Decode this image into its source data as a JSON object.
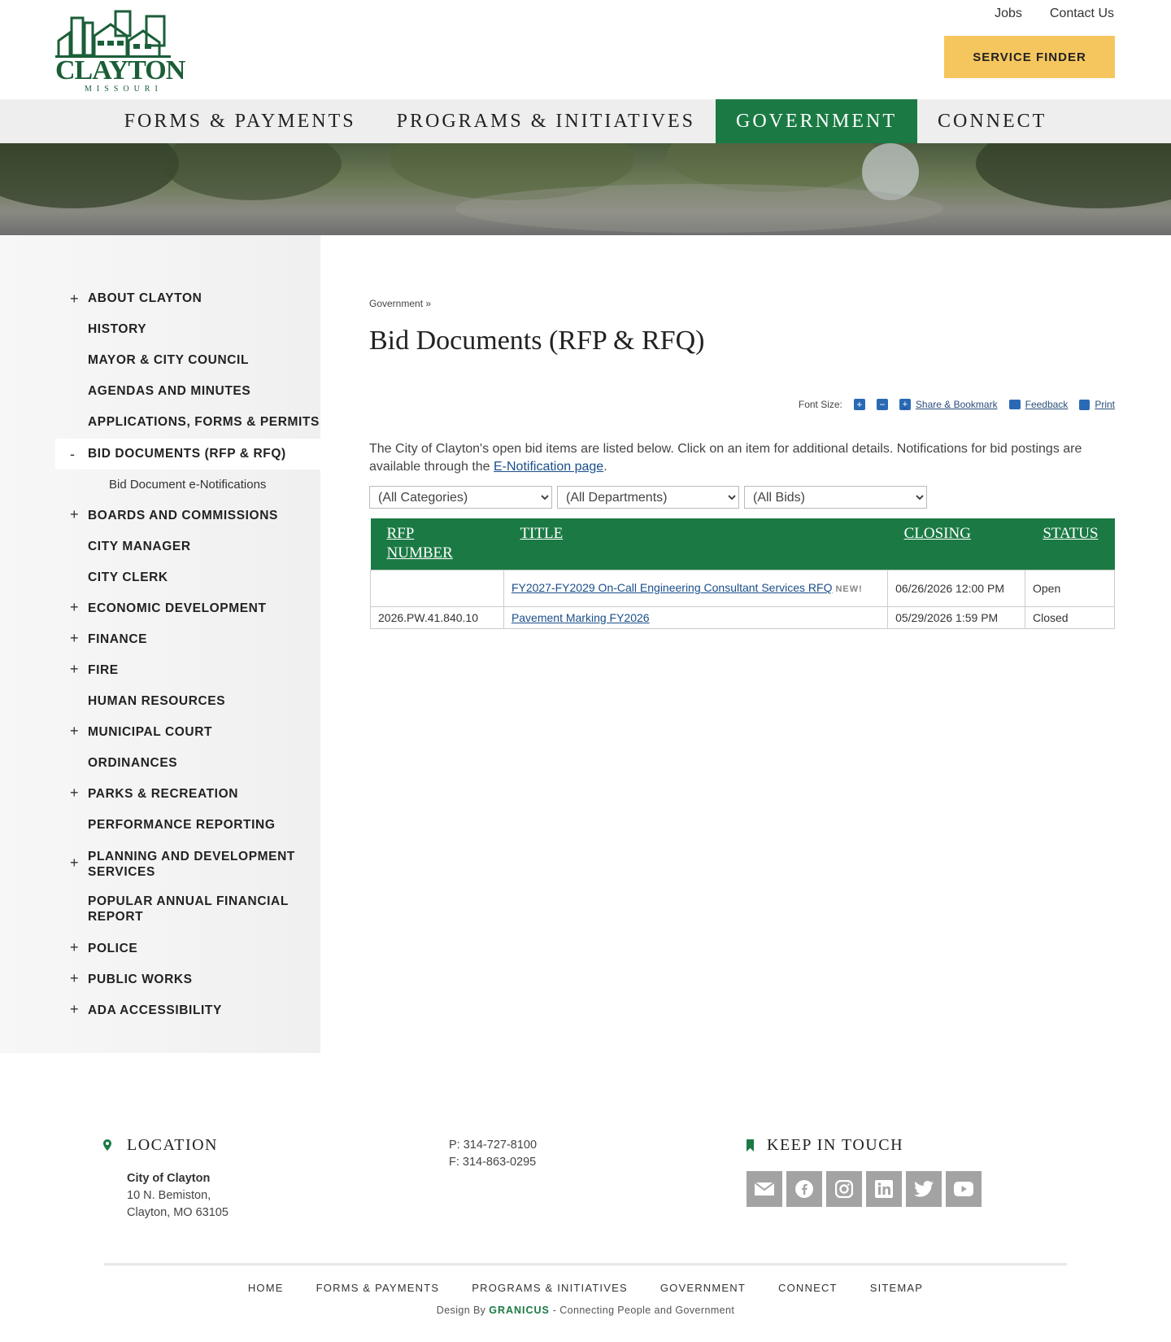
{
  "header": {
    "logo_text": "CLAYTON",
    "logo_subtext": "MISSOURI",
    "top_links": [
      "Jobs",
      "Contact Us"
    ],
    "service_finder": "SERVICE FINDER"
  },
  "nav": {
    "items": [
      "FORMS & PAYMENTS",
      "PROGRAMS & INITIATIVES",
      "GOVERNMENT",
      "CONNECT"
    ],
    "active": "GOVERNMENT"
  },
  "sidebar": {
    "items": [
      {
        "label": "ABOUT CLAYTON",
        "toggle": "+"
      },
      {
        "label": "HISTORY",
        "toggle": ""
      },
      {
        "label": "MAYOR & CITY COUNCIL",
        "toggle": ""
      },
      {
        "label": "AGENDAS AND MINUTES",
        "toggle": ""
      },
      {
        "label": "APPLICATIONS, FORMS & PERMITS",
        "toggle": ""
      },
      {
        "label": "BID DOCUMENTS (RFP & RFQ)",
        "toggle": "-"
      },
      {
        "label": "BOARDS AND COMMISSIONS",
        "toggle": "+"
      },
      {
        "label": "CITY MANAGER",
        "toggle": ""
      },
      {
        "label": "CITY CLERK",
        "toggle": ""
      },
      {
        "label": "ECONOMIC DEVELOPMENT",
        "toggle": "+"
      },
      {
        "label": "FINANCE",
        "toggle": "+"
      },
      {
        "label": "FIRE",
        "toggle": "+"
      },
      {
        "label": "HUMAN RESOURCES",
        "toggle": ""
      },
      {
        "label": "MUNICIPAL COURT",
        "toggle": "+"
      },
      {
        "label": "ORDINANCES",
        "toggle": ""
      },
      {
        "label": "PARKS & RECREATION",
        "toggle": "+"
      },
      {
        "label": "PERFORMANCE REPORTING",
        "toggle": ""
      },
      {
        "label": "PLANNING AND DEVELOPMENT SERVICES",
        "toggle": "+"
      },
      {
        "label": "POPULAR ANNUAL FINANCIAL REPORT",
        "toggle": ""
      },
      {
        "label": "POLICE",
        "toggle": "+"
      },
      {
        "label": "PUBLIC WORKS",
        "toggle": "+"
      },
      {
        "label": "ADA ACCESSIBILITY",
        "toggle": "+"
      }
    ],
    "subitem": "Bid Document e-Notifications"
  },
  "content": {
    "breadcrumb": "Government »",
    "title": "Bid Documents (RFP & RFQ)",
    "tools": {
      "font_size_label": "Font Size:",
      "increase": "+",
      "decrease": "−",
      "share": "Share & Bookmark",
      "feedback": "Feedback",
      "print": "Print"
    },
    "intro_text": "The City of Clayton's open bid items are listed below. Click on an item for additional details. Notifications for bid postings are available through the ",
    "intro_link": "E-Notification page",
    "intro_end": ".",
    "filters": {
      "categories": "(All Categories)",
      "departments": "(All Departments)",
      "bids": "(All Bids)"
    },
    "table": {
      "headers": {
        "rfp_line1": "RFP",
        "rfp_line2": "NUMBER",
        "title": "TITLE",
        "closing": "CLOSING",
        "status": "STATUS"
      },
      "rows": [
        {
          "rfp": "",
          "title": "FY2027-FY2029 On-Call Engineering Consultant Services RFQ",
          "badge": "NEW!",
          "closing": "06/26/2026 12:00 PM",
          "status": "Open"
        },
        {
          "rfp": "2026.PW.41.840.10",
          "title": "Pavement Marking FY2026",
          "badge": "",
          "closing": "05/29/2026 1:59 PM",
          "status": "Closed"
        }
      ]
    }
  },
  "footer": {
    "location_heading": "LOCATION",
    "org_name": "City of Clayton",
    "address1": "10 N. Bemiston,",
    "address2": "Clayton, MO 63105",
    "phone": "P: 314-727-8100",
    "fax": "F: 314-863-0295",
    "keep_heading": "KEEP IN TOUCH",
    "social": [
      "email-icon",
      "facebook-icon",
      "instagram-icon",
      "linkedin-icon",
      "twitter-icon",
      "youtube-icon"
    ],
    "links": [
      "HOME",
      "FORMS & PAYMENTS",
      "PROGRAMS & INITIATIVES",
      "GOVERNMENT",
      "CONNECT",
      "SITEMAP"
    ],
    "credit_prefix": "Design By ",
    "credit_brand": "GRANICUS",
    "credit_suffix": " - Connecting People and Government"
  },
  "colors": {
    "brand_green": "#1b7a44",
    "service_finder_bg": "#f6c65e",
    "link_blue": "#1a4e8a"
  }
}
